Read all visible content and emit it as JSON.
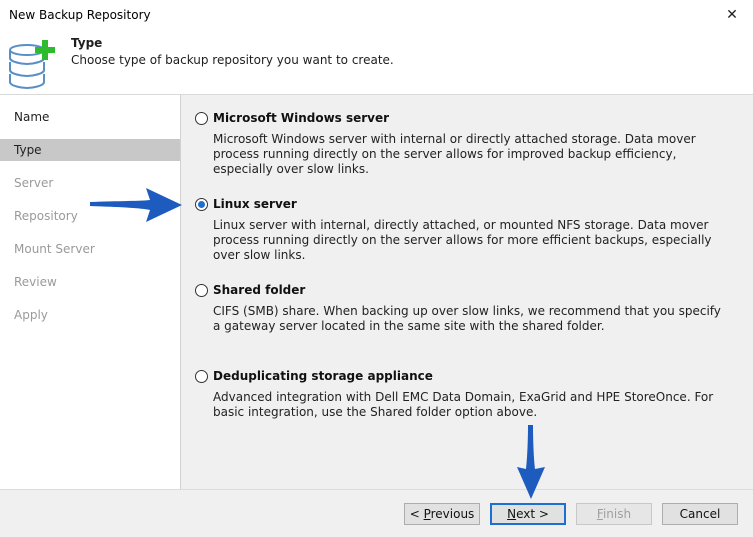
{
  "window": {
    "title": "New Backup Repository",
    "close_glyph": "✕"
  },
  "header": {
    "title": "Type",
    "subtitle": "Choose type of backup repository you want to create.",
    "icon": "database-add-icon"
  },
  "nav": {
    "items": [
      {
        "label": "Name",
        "state": "done"
      },
      {
        "label": "Type",
        "state": "active"
      },
      {
        "label": "Server",
        "state": "pending"
      },
      {
        "label": "Repository",
        "state": "pending"
      },
      {
        "label": "Mount Server",
        "state": "pending"
      },
      {
        "label": "Review",
        "state": "pending"
      },
      {
        "label": "Apply",
        "state": "pending"
      }
    ]
  },
  "options": [
    {
      "title": "Microsoft Windows server",
      "desc": "Microsoft Windows server with internal or directly attached storage. Data mover process running directly on the server allows for improved backup efficiency, especially over slow links.",
      "selected": false
    },
    {
      "title": "Linux server",
      "desc": "Linux server with internal, directly attached, or mounted NFS storage. Data mover process running directly on the server allows for more efficient backups, especially over slow links.",
      "selected": true
    },
    {
      "title": "Shared folder",
      "desc": "CIFS (SMB) share. When backing up over slow links, we recommend that you specify a gateway server located in the same site with the shared folder.",
      "selected": false
    },
    {
      "title": "Deduplicating storage appliance",
      "desc": "Advanced integration with Dell EMC Data Domain, ExaGrid and HPE StoreOnce. For basic integration, use the Shared folder option above.",
      "selected": false
    }
  ],
  "footer": {
    "previous": {
      "prefix": "< ",
      "mnemonic": "P",
      "rest": "revious"
    },
    "next": {
      "mnemonic": "N",
      "rest": "ext >"
    },
    "finish": {
      "mnemonic": "F",
      "rest": "inish"
    },
    "cancel": "Cancel"
  },
  "colors": {
    "accent": "#1f6fd1",
    "annotation_arrow": "#1d5bbf",
    "db_icon": "#5a8ec7",
    "plus_icon": "#2dbb2d"
  }
}
